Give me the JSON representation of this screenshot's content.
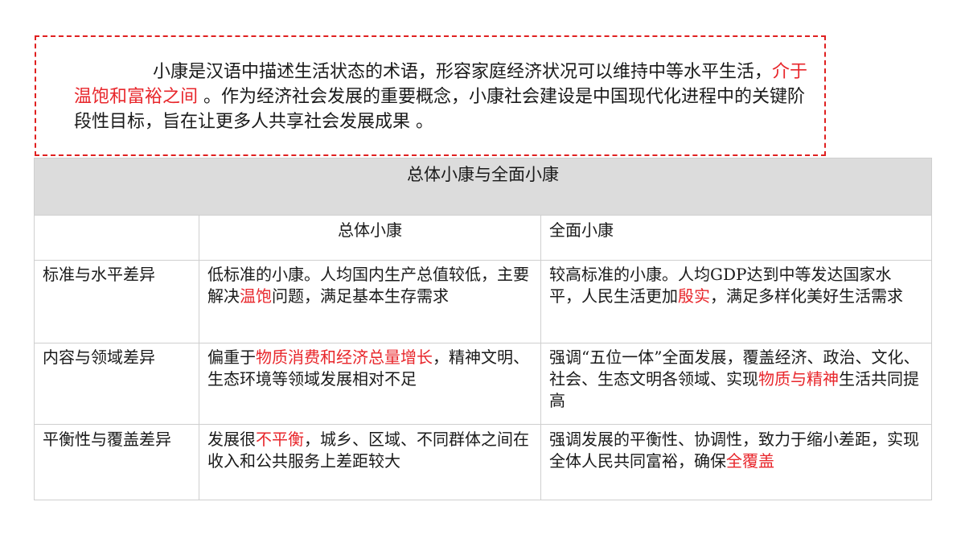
{
  "intro": {
    "part1": "小康是汉语中描述生活状态的术语，形容家庭经济状况可以维持中等水平生活，",
    "highlight": "介于温饱和富裕之间",
    "part2": " 。作为经济社会发展的重要概念，小康社会建设是中国现代化进程中的关键阶段性目标，旨在让更多人共享社会发展成果 。"
  },
  "table": {
    "title": "总体小康与全面小康",
    "headers": [
      "",
      "总体小康",
      "全面小康"
    ],
    "rows": [
      {
        "label": "标准与水平差异",
        "mid": {
          "a": "低标准的小康。人均国内生产总值较低，主要解决",
          "hl": "温饱",
          "b": "问题，满足基本生存需求"
        },
        "right": {
          "a": "较高标准的小康。人均GDP达到中等发达国家水平，人民生活更加",
          "hl": "殷实",
          "b": "，满足多样化美好生活需求"
        }
      },
      {
        "label": "内容与领域差异",
        "mid": {
          "a": "偏重于",
          "hl": "物质消费和经济总量增长",
          "b": "，精神文明、生态环境等领域发展相对不足"
        },
        "right": {
          "a": "强调“五位一体”全面发展，覆盖经济、政治、文化、社会、生态文明各领域、实现",
          "hl": "物质与精神",
          "b": "生活共同提高"
        }
      },
      {
        "label": "平衡性与覆盖差异",
        "mid": {
          "a": "发展很",
          "hl": "不平衡",
          "b": "，城乡、区域、不同群体之间在收入和公共服务上差距较大"
        },
        "right": {
          "a": "强调发展的平衡性、协调性，致力于缩小差距，实现全体人民共同富裕，确保",
          "hl": "全覆盖",
          "b": ""
        }
      }
    ]
  },
  "colors": {
    "highlight": "#e8262b",
    "dashed_border": "#e02020",
    "title_bg": "#dcdcdc",
    "grid": "#cfcfcf"
  }
}
